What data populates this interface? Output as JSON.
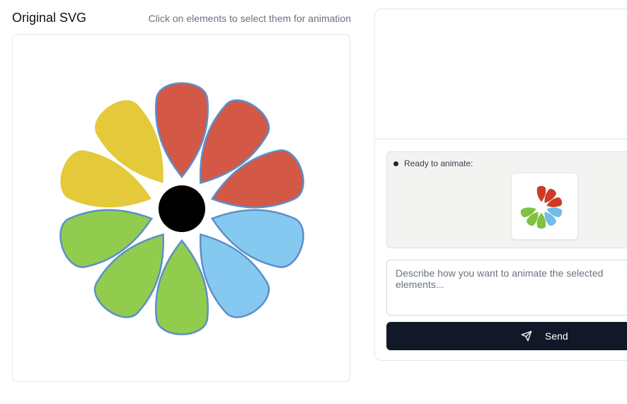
{
  "header": {
    "title": "Original SVG",
    "hint": "Click on elements to select them for animation"
  },
  "flower": {
    "colors": {
      "red": "#d35846",
      "yellow": "#e4c93a",
      "green": "#91cc4e",
      "blue": "#86c9f0",
      "center": "#000000",
      "selection_outline": "#5b8fc9"
    }
  },
  "panel": {
    "ready_label": "Ready to animate:",
    "thumbnail_colors": {
      "red": "#cf3a25",
      "green": "#7fc23f",
      "blue": "#6fbde8"
    },
    "prompt_placeholder": "Describe how you want to animate the selected elements...",
    "send_label": "Send",
    "send_icon": "send-icon"
  }
}
